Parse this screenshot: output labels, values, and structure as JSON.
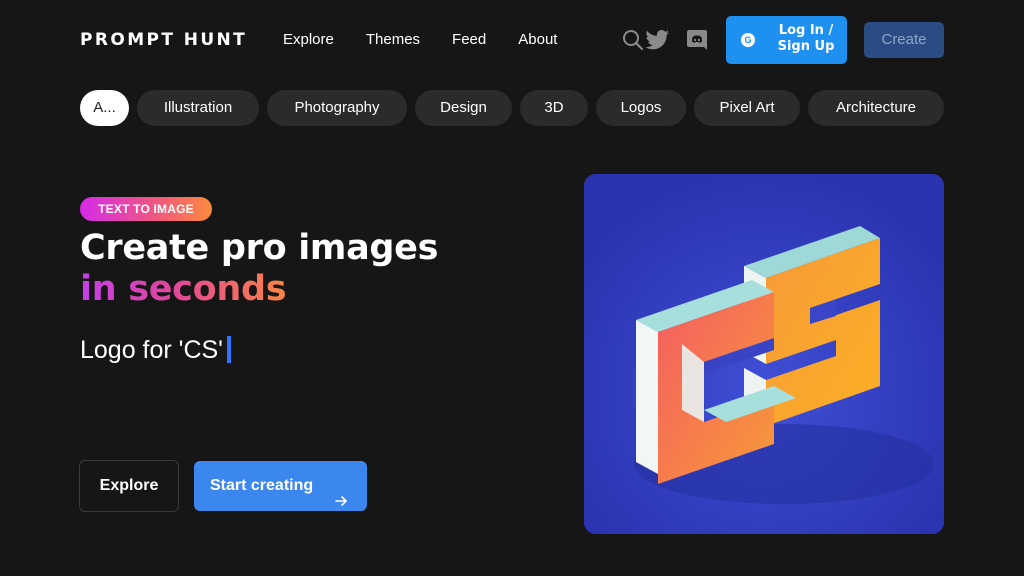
{
  "header": {
    "logo": "PROMPT HUNT",
    "nav": [
      "Explore",
      "Themes",
      "Feed",
      "About"
    ],
    "login_label": "Log In / Sign Up",
    "google_glyph": "G",
    "create_label": "Create",
    "icons": [
      "search-icon",
      "twitter-icon",
      "discord-icon",
      "google-icon"
    ]
  },
  "categories": {
    "items": [
      "A...",
      "Illustration",
      "Photography",
      "Design",
      "3D",
      "Logos",
      "Pixel Art",
      "Architecture"
    ],
    "active_index": 0
  },
  "hero": {
    "badge": "TEXT TO IMAGE",
    "title_line1": "Create pro images",
    "title_line2": "in seconds",
    "prompt_text": "Logo for 'CS'",
    "explore_label": "Explore",
    "start_label": "Start creating",
    "image_alt_icon": "isometric-cs-logo"
  },
  "colors": {
    "background": "#161616",
    "accent_blue": "#1e90ef",
    "start_button": "#3b87ee",
    "chip_bg": "#2b2b2b",
    "image_bg": "#2c38b4",
    "gradient_start": "#c43fe9",
    "gradient_end": "#f98544"
  }
}
